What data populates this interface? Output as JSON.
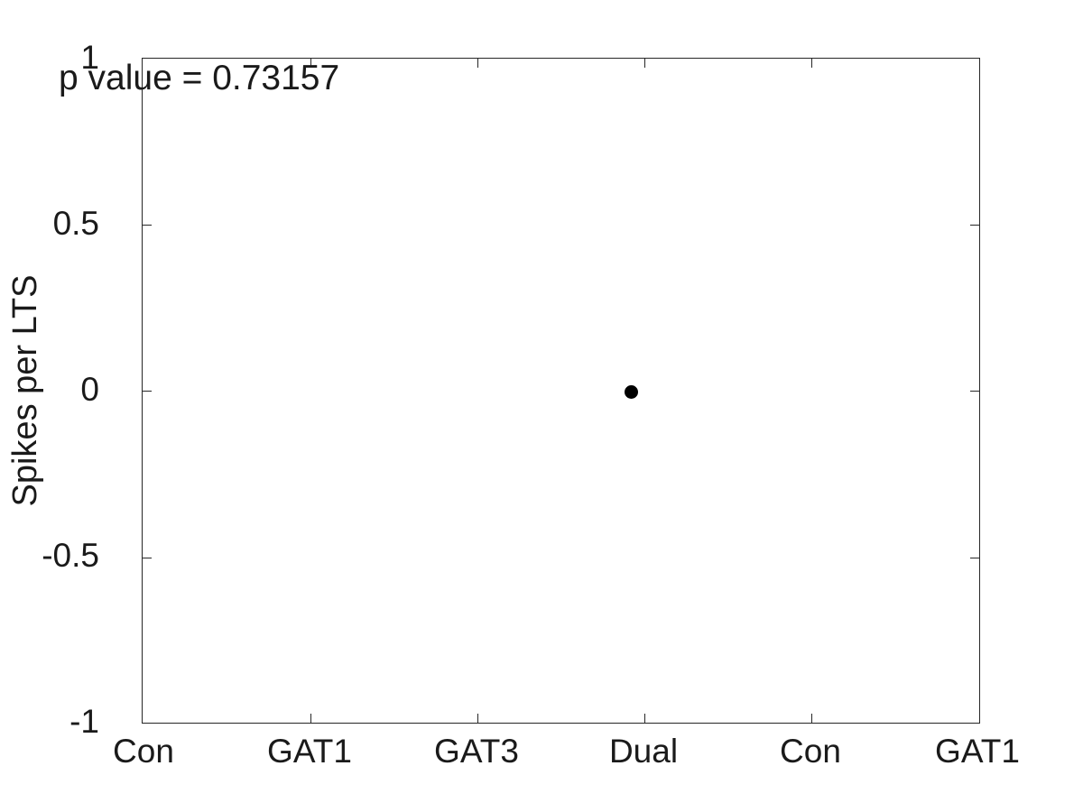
{
  "chart_data": {
    "type": "scatter",
    "title": "",
    "subtitle": "",
    "xlabel": "",
    "ylabel": "Spikes per LTS",
    "categories": [
      "Con",
      "GAT1",
      "GAT3",
      "Dual",
      "Con",
      "GAT1"
    ],
    "xticklabels": [
      "Con",
      "GAT1",
      "GAT3",
      "Dual",
      "Con",
      "GAT1"
    ],
    "xtick_positions": [
      1,
      2,
      3,
      4,
      5,
      6
    ],
    "xlim": [
      0.5,
      6.5
    ],
    "yticklabels": [
      "1",
      "0.5",
      "0",
      "-0.5",
      "-1"
    ],
    "ytick_values": [
      1,
      0.5,
      0,
      -0.5,
      -1
    ],
    "ylim": [
      -1,
      1
    ],
    "grid": false,
    "legend": null,
    "marker": "filled-circle",
    "marker_color": "#000000",
    "marker_size_px": 15,
    "points": [
      {
        "x": 4,
        "y": 0,
        "category": "Dual",
        "label": ""
      }
    ],
    "annotations": [
      {
        "name": "p-value",
        "text": "p value = 0.73157",
        "value": 0.73157
      }
    ]
  },
  "annotation": {
    "p_value_text": "p value = 0.73157"
  },
  "axes": {
    "y_title": "Spikes per LTS",
    "y_ticks": [
      {
        "label": "1",
        "value": 1
      },
      {
        "label": "0.5",
        "value": 0.5
      },
      {
        "label": "0",
        "value": 0
      },
      {
        "label": "-0.5",
        "value": -0.5
      },
      {
        "label": "-1",
        "value": -1
      }
    ],
    "x_ticks": [
      {
        "label": "Con",
        "value": 1
      },
      {
        "label": "GAT1",
        "value": 2
      },
      {
        "label": "GAT3",
        "value": 3
      },
      {
        "label": "Dual",
        "value": 4
      },
      {
        "label": "Con",
        "value": 5
      },
      {
        "label": "GAT1",
        "value": 6
      }
    ]
  },
  "style": {
    "axis_color": "#262626",
    "text_color": "#1a1a1a",
    "background": "#ffffff",
    "marker_color": "#000000"
  }
}
